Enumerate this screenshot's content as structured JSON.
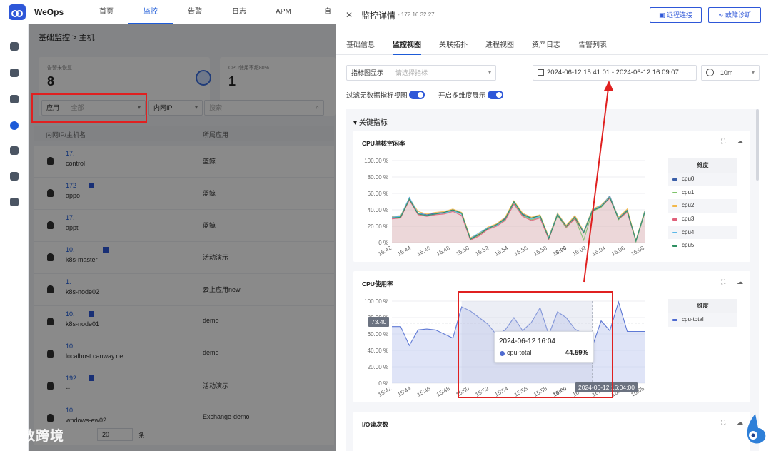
{
  "app": {
    "brand": "WeOps"
  },
  "nav": [
    "首页",
    "监控",
    "告警",
    "日志",
    "APM",
    "自"
  ],
  "main": {
    "breadcrumb": "基础监控 > 主机",
    "cards": [
      {
        "label": "告警未恢复",
        "value": "8"
      },
      {
        "label": "CPU使用率超80%",
        "value": "1"
      }
    ],
    "filter": {
      "app_label": "应用",
      "app_value": "全部",
      "ip_label": "内网IP",
      "search_placeholder": "搜索"
    },
    "columns": [
      "内网IP/主机名",
      "所属应用"
    ],
    "rows": [
      {
        "ip": "17.",
        "host": "control",
        "app": "蓝鲸"
      },
      {
        "ip": "172",
        "host": "appo",
        "app": "蓝鲸"
      },
      {
        "ip": "17.",
        "host": "appt",
        "app": "蓝鲸"
      },
      {
        "ip": "10.",
        "host": "k8s-master",
        "app": "活动演示"
      },
      {
        "ip": "1.",
        "host": "k8s-node02",
        "app": "云上应用new"
      },
      {
        "ip": "10.",
        "host": "k8s-node01",
        "app": "demo"
      },
      {
        "ip": "10.",
        "host": "localhost.canway.net",
        "app": "demo"
      },
      {
        "ip": "192",
        "host": "--",
        "app": "活动演示"
      },
      {
        "ip": "10",
        "host": "wndows-ew02",
        "app": "Exchange-demo"
      }
    ],
    "pager": {
      "size": "20",
      "unit": "条"
    }
  },
  "watermark": "大数跨境",
  "drawer": {
    "title": "监控详情",
    "ip": "- 172.16.32.27",
    "buttons": {
      "remote": "远程连接",
      "diagnose": "故障诊断"
    },
    "tabs": [
      "基础信息",
      "监控视图",
      "关联拓扑",
      "进程视图",
      "资产日志",
      "告警列表"
    ],
    "active_tab": "监控视图",
    "metric_label": "指标图显示",
    "metric_placeholder": "请选择指标",
    "time_range": "2024-06-12 15:41:01 - 2024-06-12 16:09:07",
    "refresh": "10m",
    "toggle1": "过滤无数据指标视图",
    "toggle2": "开启多维度展示",
    "section": "关键指标",
    "io_title": "I/O读次数"
  },
  "chart_data": [
    {
      "type": "line",
      "title": "CPU单核空闲率",
      "legend_title": "维度",
      "xlabel": "",
      "ylabel": "",
      "y_tick_labels": [
        "100.00 %",
        "80.00 %",
        "60.00 %",
        "40.00 %",
        "20.00 %",
        "0 %"
      ],
      "x_tick_labels": [
        "15:42",
        "15:44",
        "15:46",
        "15:48",
        "15:50",
        "15:52",
        "15:54",
        "15:56",
        "15:58",
        "16:00",
        "16:02",
        "16:04",
        "16:06",
        "16:08"
      ],
      "ylim": [
        0,
        100
      ],
      "x": [
        0,
        1,
        2,
        3,
        4,
        5,
        6,
        7,
        8,
        9,
        10,
        11,
        12,
        13,
        14,
        15,
        16,
        17,
        18,
        19,
        20,
        21,
        22,
        23,
        24,
        25,
        26,
        27,
        28,
        29
      ],
      "series": [
        {
          "name": "cpu0",
          "color": "#3b5fa8",
          "values": [
            31,
            32,
            55,
            36,
            34,
            36,
            37,
            40,
            36,
            5,
            10,
            18,
            22,
            30,
            50,
            35,
            30,
            33,
            6,
            35,
            20,
            32,
            13,
            40,
            45,
            57,
            30,
            40,
            2,
            38
          ]
        },
        {
          "name": "cpu1",
          "color": "#7ec36a",
          "values": [
            30,
            31,
            53,
            35,
            33,
            35,
            36,
            39,
            35,
            4,
            9,
            17,
            21,
            28,
            48,
            33,
            28,
            31,
            5,
            33,
            18,
            30,
            3,
            38,
            43,
            55,
            28,
            38,
            1,
            36
          ]
        },
        {
          "name": "cpu2",
          "color": "#f2b84b",
          "values": [
            32,
            33,
            54,
            38,
            35,
            37,
            38,
            41,
            37,
            6,
            11,
            19,
            23,
            31,
            51,
            36,
            31,
            34,
            7,
            36,
            21,
            33,
            14,
            41,
            46,
            56,
            31,
            41,
            3,
            39
          ]
        },
        {
          "name": "cpu3",
          "color": "#e0607a",
          "values": [
            29,
            30,
            52,
            34,
            32,
            34,
            35,
            38,
            33,
            3,
            8,
            16,
            20,
            27,
            47,
            32,
            27,
            30,
            4,
            34,
            19,
            29,
            12,
            39,
            44,
            54,
            29,
            37,
            2,
            37
          ]
        },
        {
          "name": "cpu4",
          "color": "#5bb8e8",
          "values": [
            31,
            32,
            55,
            36,
            33,
            35,
            36,
            39,
            35,
            5,
            12,
            18,
            21,
            29,
            49,
            34,
            29,
            32,
            6,
            35,
            20,
            31,
            13,
            40,
            45,
            56,
            30,
            39,
            2,
            38
          ]
        },
        {
          "name": "cpu5",
          "color": "#2e8f61",
          "values": [
            30,
            31,
            53,
            35,
            33,
            35,
            37,
            40,
            36,
            4,
            10,
            17,
            22,
            29,
            50,
            34,
            30,
            33,
            5,
            34,
            20,
            31,
            12,
            39,
            44,
            55,
            29,
            39,
            2,
            37
          ]
        }
      ]
    },
    {
      "type": "area",
      "title": "CPU使用率",
      "legend_title": "维度",
      "xlabel": "",
      "ylabel": "",
      "y_tick_labels": [
        "100.00 %",
        "80.00 %",
        "60.00 %",
        "40.00 %",
        "20.00 %",
        "0 %"
      ],
      "x_tick_labels": [
        "15:42",
        "15:44",
        "15:46",
        "15:48",
        "15:50",
        "15:52",
        "15:54",
        "15:56",
        "15:58",
        "16:00",
        "16:02",
        "16:04",
        "16:06",
        "16:08"
      ],
      "ylim": [
        0,
        100
      ],
      "x": [
        0,
        1,
        2,
        3,
        4,
        5,
        6,
        7,
        8,
        9,
        10,
        11,
        12,
        13,
        14,
        15,
        16,
        17,
        18,
        19,
        20,
        21,
        22,
        23,
        24,
        25,
        26,
        27,
        28,
        29
      ],
      "series": [
        {
          "name": "cpu-total",
          "color": "#4f6bd0",
          "values": [
            69,
            69,
            46,
            65,
            66,
            65,
            60,
            55,
            93,
            88,
            80,
            72,
            59,
            65,
            80,
            64,
            74,
            92,
            59,
            87,
            80,
            66,
            60,
            45,
            76,
            64,
            99,
            63,
            63,
            63
          ]
        }
      ],
      "reference_line": {
        "label": "73.40",
        "value": 73.4
      },
      "tooltip": {
        "time": "2024-06-12 16:04",
        "series": "cpu-total",
        "value": "44.59%"
      },
      "crosshair_label": "2024-06-12 16:04:00"
    }
  ]
}
